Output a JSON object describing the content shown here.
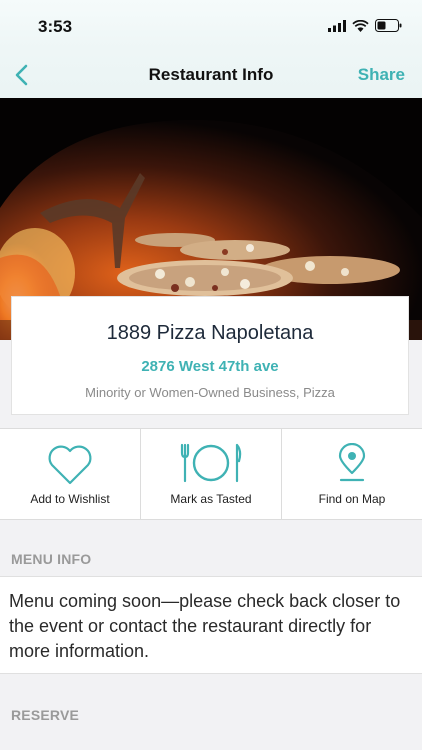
{
  "status_bar": {
    "time": "3:53"
  },
  "nav": {
    "title": "Restaurant Info",
    "share_label": "Share",
    "accent_color": "#3fb2b4"
  },
  "restaurant": {
    "name": "1889 Pizza Napoletana",
    "address": "2876 West 47th ave",
    "categories": "Minority or Women-Owned Business, Pizza"
  },
  "actions": [
    {
      "label": "Add to Wishlist",
      "icon": "heart-icon"
    },
    {
      "label": "Mark as Tasted",
      "icon": "plate-utensils-icon"
    },
    {
      "label": "Find on Map",
      "icon": "map-pin-icon"
    }
  ],
  "menu_info": {
    "header": "MENU INFO",
    "text": "Menu coming soon—please check back closer to the event or contact the restaurant directly for more information."
  },
  "reserve": {
    "header": "RESERVE"
  }
}
